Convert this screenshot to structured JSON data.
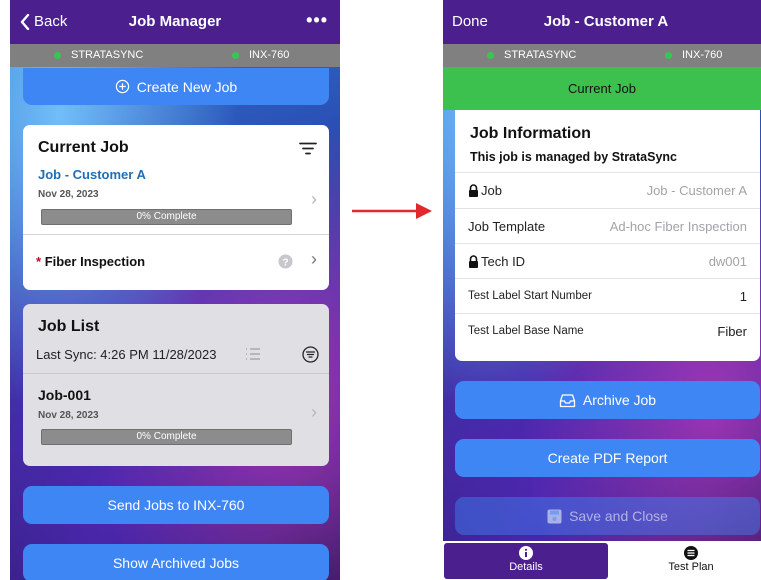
{
  "left": {
    "nav": {
      "back_label": "Back",
      "title": "Job Manager",
      "more": "•••"
    },
    "status": {
      "left_label": "STRATASYNC",
      "right_label": "INX-760",
      "dot_color": "#35c653"
    },
    "create_button": "Create New Job",
    "current_job": {
      "title": "Current Job",
      "job_name": "Job - Customer A",
      "date": "Nov 28, 2023",
      "progress_label": "0% Complete",
      "progress": 0,
      "required_mark": "*",
      "task_label": "Fiber Inspection"
    },
    "job_list": {
      "title": "Job List",
      "last_sync": "Last Sync: 4:26 PM 11/28/2023",
      "items": [
        {
          "name": "Job-001",
          "date": "Nov 28, 2023",
          "progress_label": "0% Complete",
          "progress": 0
        }
      ]
    },
    "send_button": "Send Jobs to INX-760",
    "archived_button": "Show Archived Jobs"
  },
  "right": {
    "nav": {
      "done_label": "Done",
      "title": "Job - Customer A"
    },
    "status": {
      "left_label": "STRATASYNC",
      "right_label": "INX-760"
    },
    "current_job_banner": "Current Job",
    "banner_color": "#3cc04e",
    "info": {
      "title": "Job Information",
      "subtitle": "This job is managed by StrataSync",
      "rows": [
        {
          "label": "Job",
          "value": "Job - Customer A",
          "locked": true
        },
        {
          "label": "Job Template",
          "value": "Ad-hoc Fiber Inspection",
          "locked": false
        },
        {
          "label": "Tech ID",
          "value": "dw001",
          "locked": true
        },
        {
          "label": "Test Label Start Number",
          "value": "1",
          "locked": false
        },
        {
          "label": "Test Label Base Name",
          "value": "Fiber",
          "locked": false
        }
      ]
    },
    "archive_button": "Archive Job",
    "pdf_button": "Create PDF Report",
    "save_button": "Save and Close",
    "tabs": [
      {
        "label": "Details",
        "icon": "info-icon"
      },
      {
        "label": "Test Plan",
        "icon": "list-icon"
      }
    ]
  },
  "colors": {
    "nav": "#4c1f8f",
    "button": "#3f86f5",
    "arrow": "#e0282d",
    "link": "#1f6fb5",
    "required": "#d0021b"
  }
}
